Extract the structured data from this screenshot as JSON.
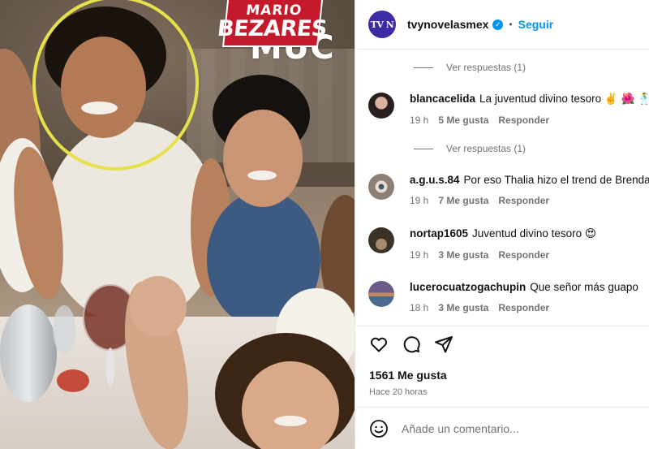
{
  "photo": {
    "banner_line1": "MARIO",
    "banner_line2": "BEZARES",
    "overlay_text": "MUC"
  },
  "header": {
    "avatar_text": "TV N",
    "username": "tvynovelasmex",
    "follow_label": "Seguir"
  },
  "comments": [
    {
      "replies_label": "Ver respuestas (1)"
    },
    {
      "user": "blancacelida",
      "text": "La juventud divino tesoro ✌️ 🌺 🕺",
      "time": "19 h",
      "likes": "5 Me gusta",
      "reply": "Responder",
      "replies_label": "Ver respuestas (1)",
      "avatar_color": "#2a1f1f"
    },
    {
      "user": "a.g.u.s.84",
      "text": "Por eso Thalia hizo el trend de Brenda",
      "time": "19 h",
      "likes": "7 Me gusta",
      "reply": "Responder",
      "avatar_color": "#8e7f74"
    },
    {
      "user": "nortap1605",
      "text": "Juventud divino tesoro 😍",
      "time": "19 h",
      "likes": "3 Me gusta",
      "reply": "Responder",
      "avatar_color": "#3a3127"
    },
    {
      "user": "lucerocuatzogachupin",
      "text": "Que señor más guapo",
      "time": "18 h",
      "likes": "3 Me gusta",
      "reply": "Responder",
      "avatar_color": "#6b5a8a"
    }
  ],
  "post": {
    "likes": "1561 Me gusta",
    "time_ago": "Hace 20 horas"
  },
  "composer": {
    "placeholder": "Añade un comentario..."
  },
  "colors": {
    "accent": "#0095f6",
    "brand_avatar": "#3b2ca3",
    "meta_text": "#737373",
    "banner_red": "#c41a2b",
    "highlight_ring": "#e6e04a"
  }
}
